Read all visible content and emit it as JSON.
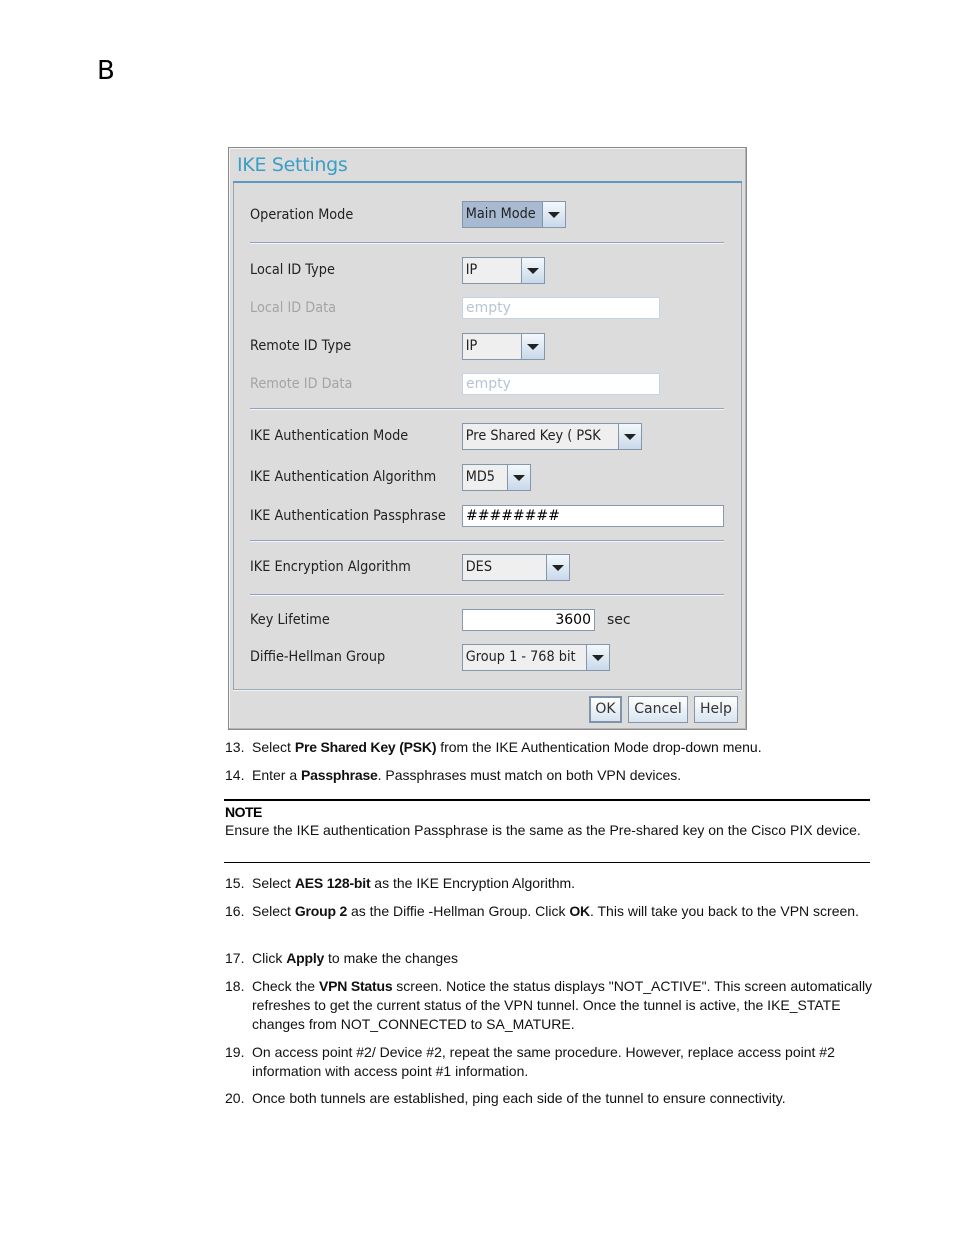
{
  "page": {
    "chapter_letter": "B"
  },
  "dialog": {
    "title": "IKE Settings",
    "fields": {
      "operation_mode": {
        "label": "Operation Mode",
        "value": "Main Mode"
      },
      "local_id_type": {
        "label": "Local ID Type",
        "value": "IP"
      },
      "local_id_data": {
        "label": "Local ID Data",
        "value": "empty"
      },
      "remote_id_type": {
        "label": "Remote ID Type",
        "value": "IP"
      },
      "remote_id_data": {
        "label": "Remote ID Data",
        "value": "empty"
      },
      "auth_mode": {
        "label": "IKE Authentication Mode",
        "value": "Pre Shared Key ( PSK )"
      },
      "auth_algorithm": {
        "label": "IKE Authentication Algorithm",
        "value": "MD5"
      },
      "auth_passphrase": {
        "label": "IKE Authentication Passphrase",
        "value": "########"
      },
      "encryption_algorithm": {
        "label": "IKE Encryption Algorithm",
        "value": "DES"
      },
      "key_lifetime": {
        "label": "Key Lifetime",
        "value": "3600",
        "unit": "sec"
      },
      "dh_group": {
        "label": "Diffie-Hellman Group",
        "value": "Group 1 - 768 bit"
      }
    },
    "buttons": {
      "ok": "OK",
      "cancel": "Cancel",
      "help": "Help"
    }
  },
  "steps": [
    {
      "num": "13.",
      "parts": [
        "Select ",
        "Pre Shared Key (PSK)",
        " from the IKE Authentication Mode drop-down menu."
      ]
    },
    {
      "num": "14.",
      "parts": [
        "Enter a ",
        "Passphrase",
        ". Passphrases must match on both VPN devices."
      ]
    },
    {
      "num": "15.",
      "parts": [
        "Select ",
        "AES 128-bit",
        " as the IKE Encryption Algorithm."
      ]
    },
    {
      "num": "16.",
      "parts": [
        "Select ",
        "Group 2",
        " as the Diffie -Hellman Group. Click ",
        "OK",
        ". This will take you back to the VPN screen."
      ]
    },
    {
      "num": "17.",
      "parts": [
        "Click ",
        "Apply",
        " to make the changes"
      ]
    },
    {
      "num": "18.",
      "parts": [
        "Check the ",
        "VPN Status",
        " screen. Notice the status displays \"NOT_ACTIVE\". This screen automatically refreshes to get the current status of the VPN tunnel. Once the tunnel is active, the IKE_STATE changes from NOT_CONNECTED to SA_MATURE."
      ]
    },
    {
      "num": "19.",
      "parts": [
        "On access point #2/ Device #2, repeat the same procedure. However, replace access point #2 information with access point #1 information."
      ]
    },
    {
      "num": "20.",
      "parts": [
        "Once both tunnels are established, ping each side of the tunnel to ensure connectivity."
      ]
    }
  ],
  "note": {
    "heading": "NOTE",
    "text": "Ensure the IKE authentication Passphrase is the same as the Pre-shared key on the Cisco PIX device."
  }
}
